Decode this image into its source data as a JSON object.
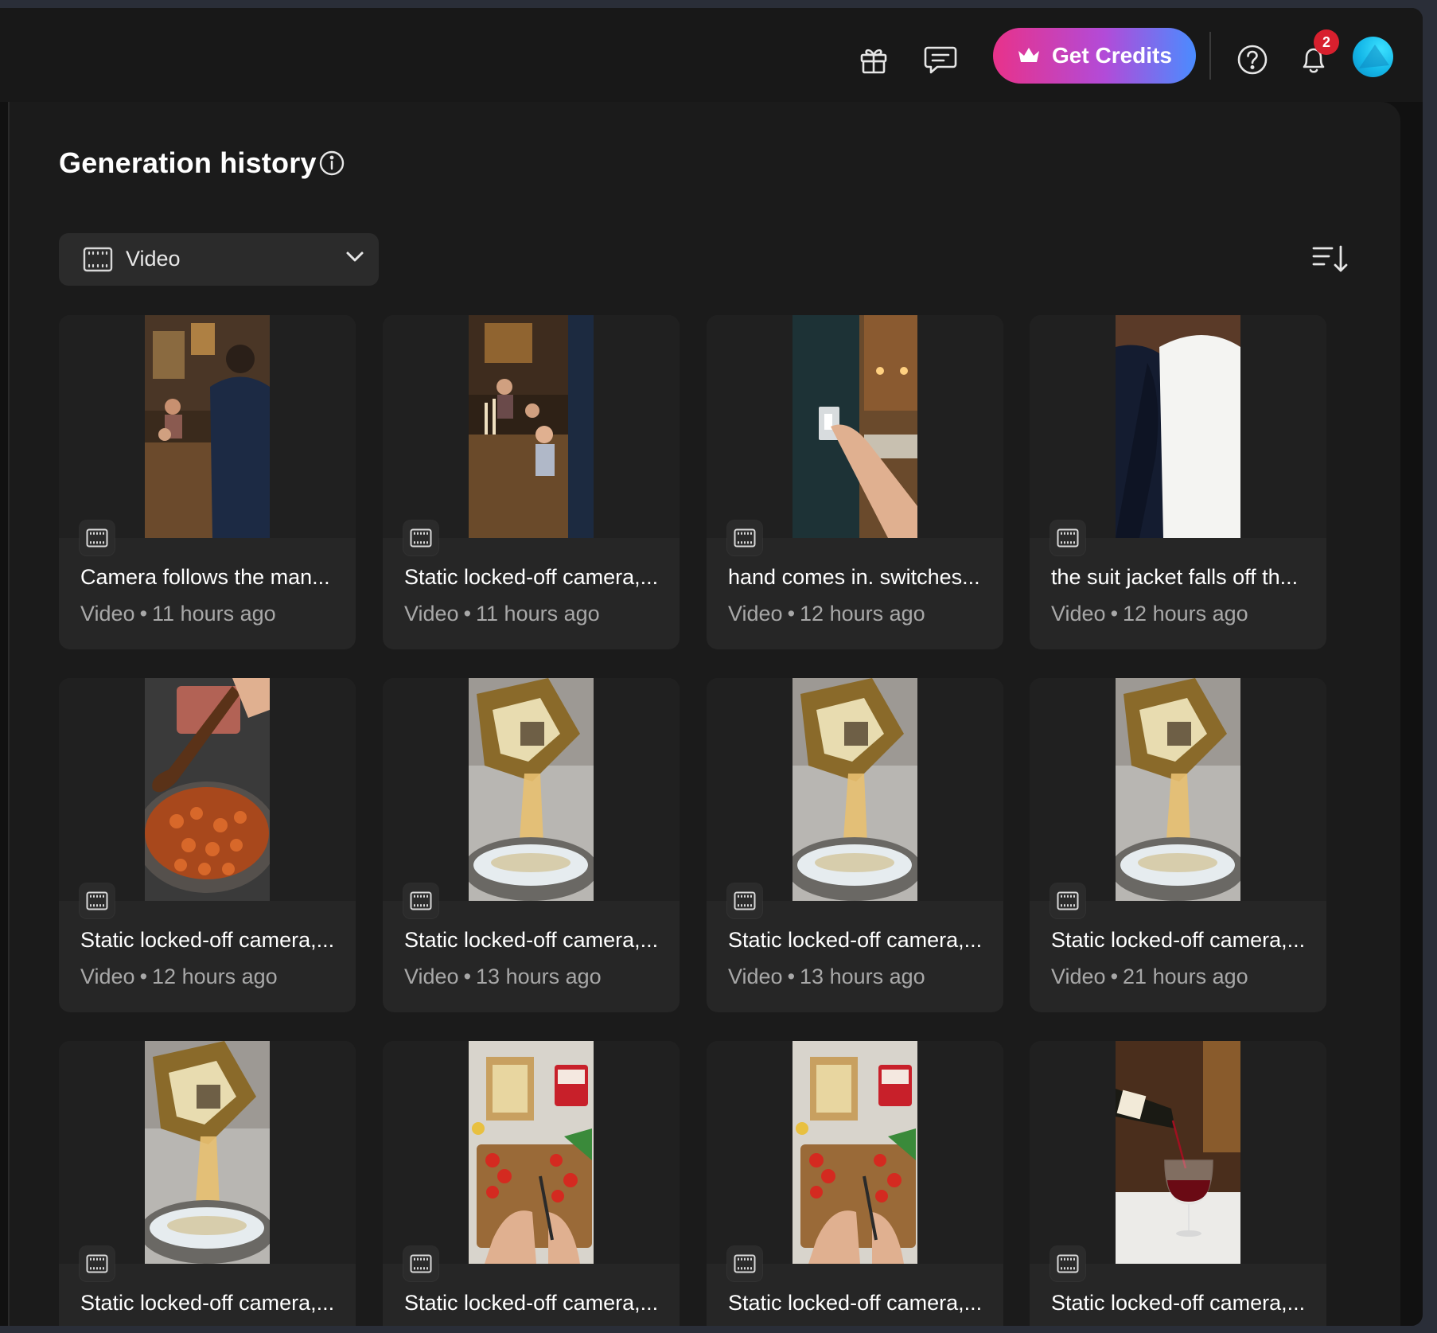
{
  "topbar": {
    "gift_icon": "gift-icon",
    "feedback_icon": "chat-bubble-icon",
    "credits_label": "Get Credits",
    "credits_icon": "crown-icon",
    "help_icon": "question-circle-icon",
    "bell_icon": "bell-icon",
    "notification_count": "2",
    "colors": {
      "credits_from": "#e8328a",
      "credits_to": "#4a8cff",
      "badge": "#d8202e"
    }
  },
  "header": {
    "title": "Generation history",
    "info_icon": "info-circle-icon"
  },
  "filter": {
    "icon": "film-icon",
    "selected": "Video",
    "chevron": "chevron-down-icon"
  },
  "sort_icon": "sort-descending-icon",
  "cards": [
    {
      "title": "Camera follows the man...",
      "type": "Video",
      "time": "11 hours ago",
      "scene": "dinner-man"
    },
    {
      "title": "Static locked-off camera,...",
      "type": "Video",
      "time": "11 hours ago",
      "scene": "dinner-table"
    },
    {
      "title": "hand comes in. switches...",
      "type": "Video",
      "time": "12 hours ago",
      "scene": "light-switch"
    },
    {
      "title": "the suit jacket falls off th...",
      "type": "Video",
      "time": "12 hours ago",
      "scene": "suit-jacket"
    },
    {
      "title": "Static locked-off camera,...",
      "type": "Video",
      "time": "12 hours ago",
      "scene": "pasta-pan"
    },
    {
      "title": "Static locked-off camera,...",
      "type": "Video",
      "time": "13 hours ago",
      "scene": "pasta-pour"
    },
    {
      "title": "Static locked-off camera,...",
      "type": "Video",
      "time": "13 hours ago",
      "scene": "pasta-pour"
    },
    {
      "title": "Static locked-off camera,...",
      "type": "Video",
      "time": "21 hours ago",
      "scene": "pasta-pour"
    },
    {
      "title": "Static locked-off camera,...",
      "type": "",
      "time": "",
      "scene": "pasta-pour"
    },
    {
      "title": "Static locked-off camera,...",
      "type": "",
      "time": "",
      "scene": "cutting-board"
    },
    {
      "title": "Static locked-off camera,...",
      "type": "",
      "time": "",
      "scene": "cutting-board"
    },
    {
      "title": "Static locked-off camera,...",
      "type": "",
      "time": "",
      "scene": "wine-pour"
    }
  ]
}
